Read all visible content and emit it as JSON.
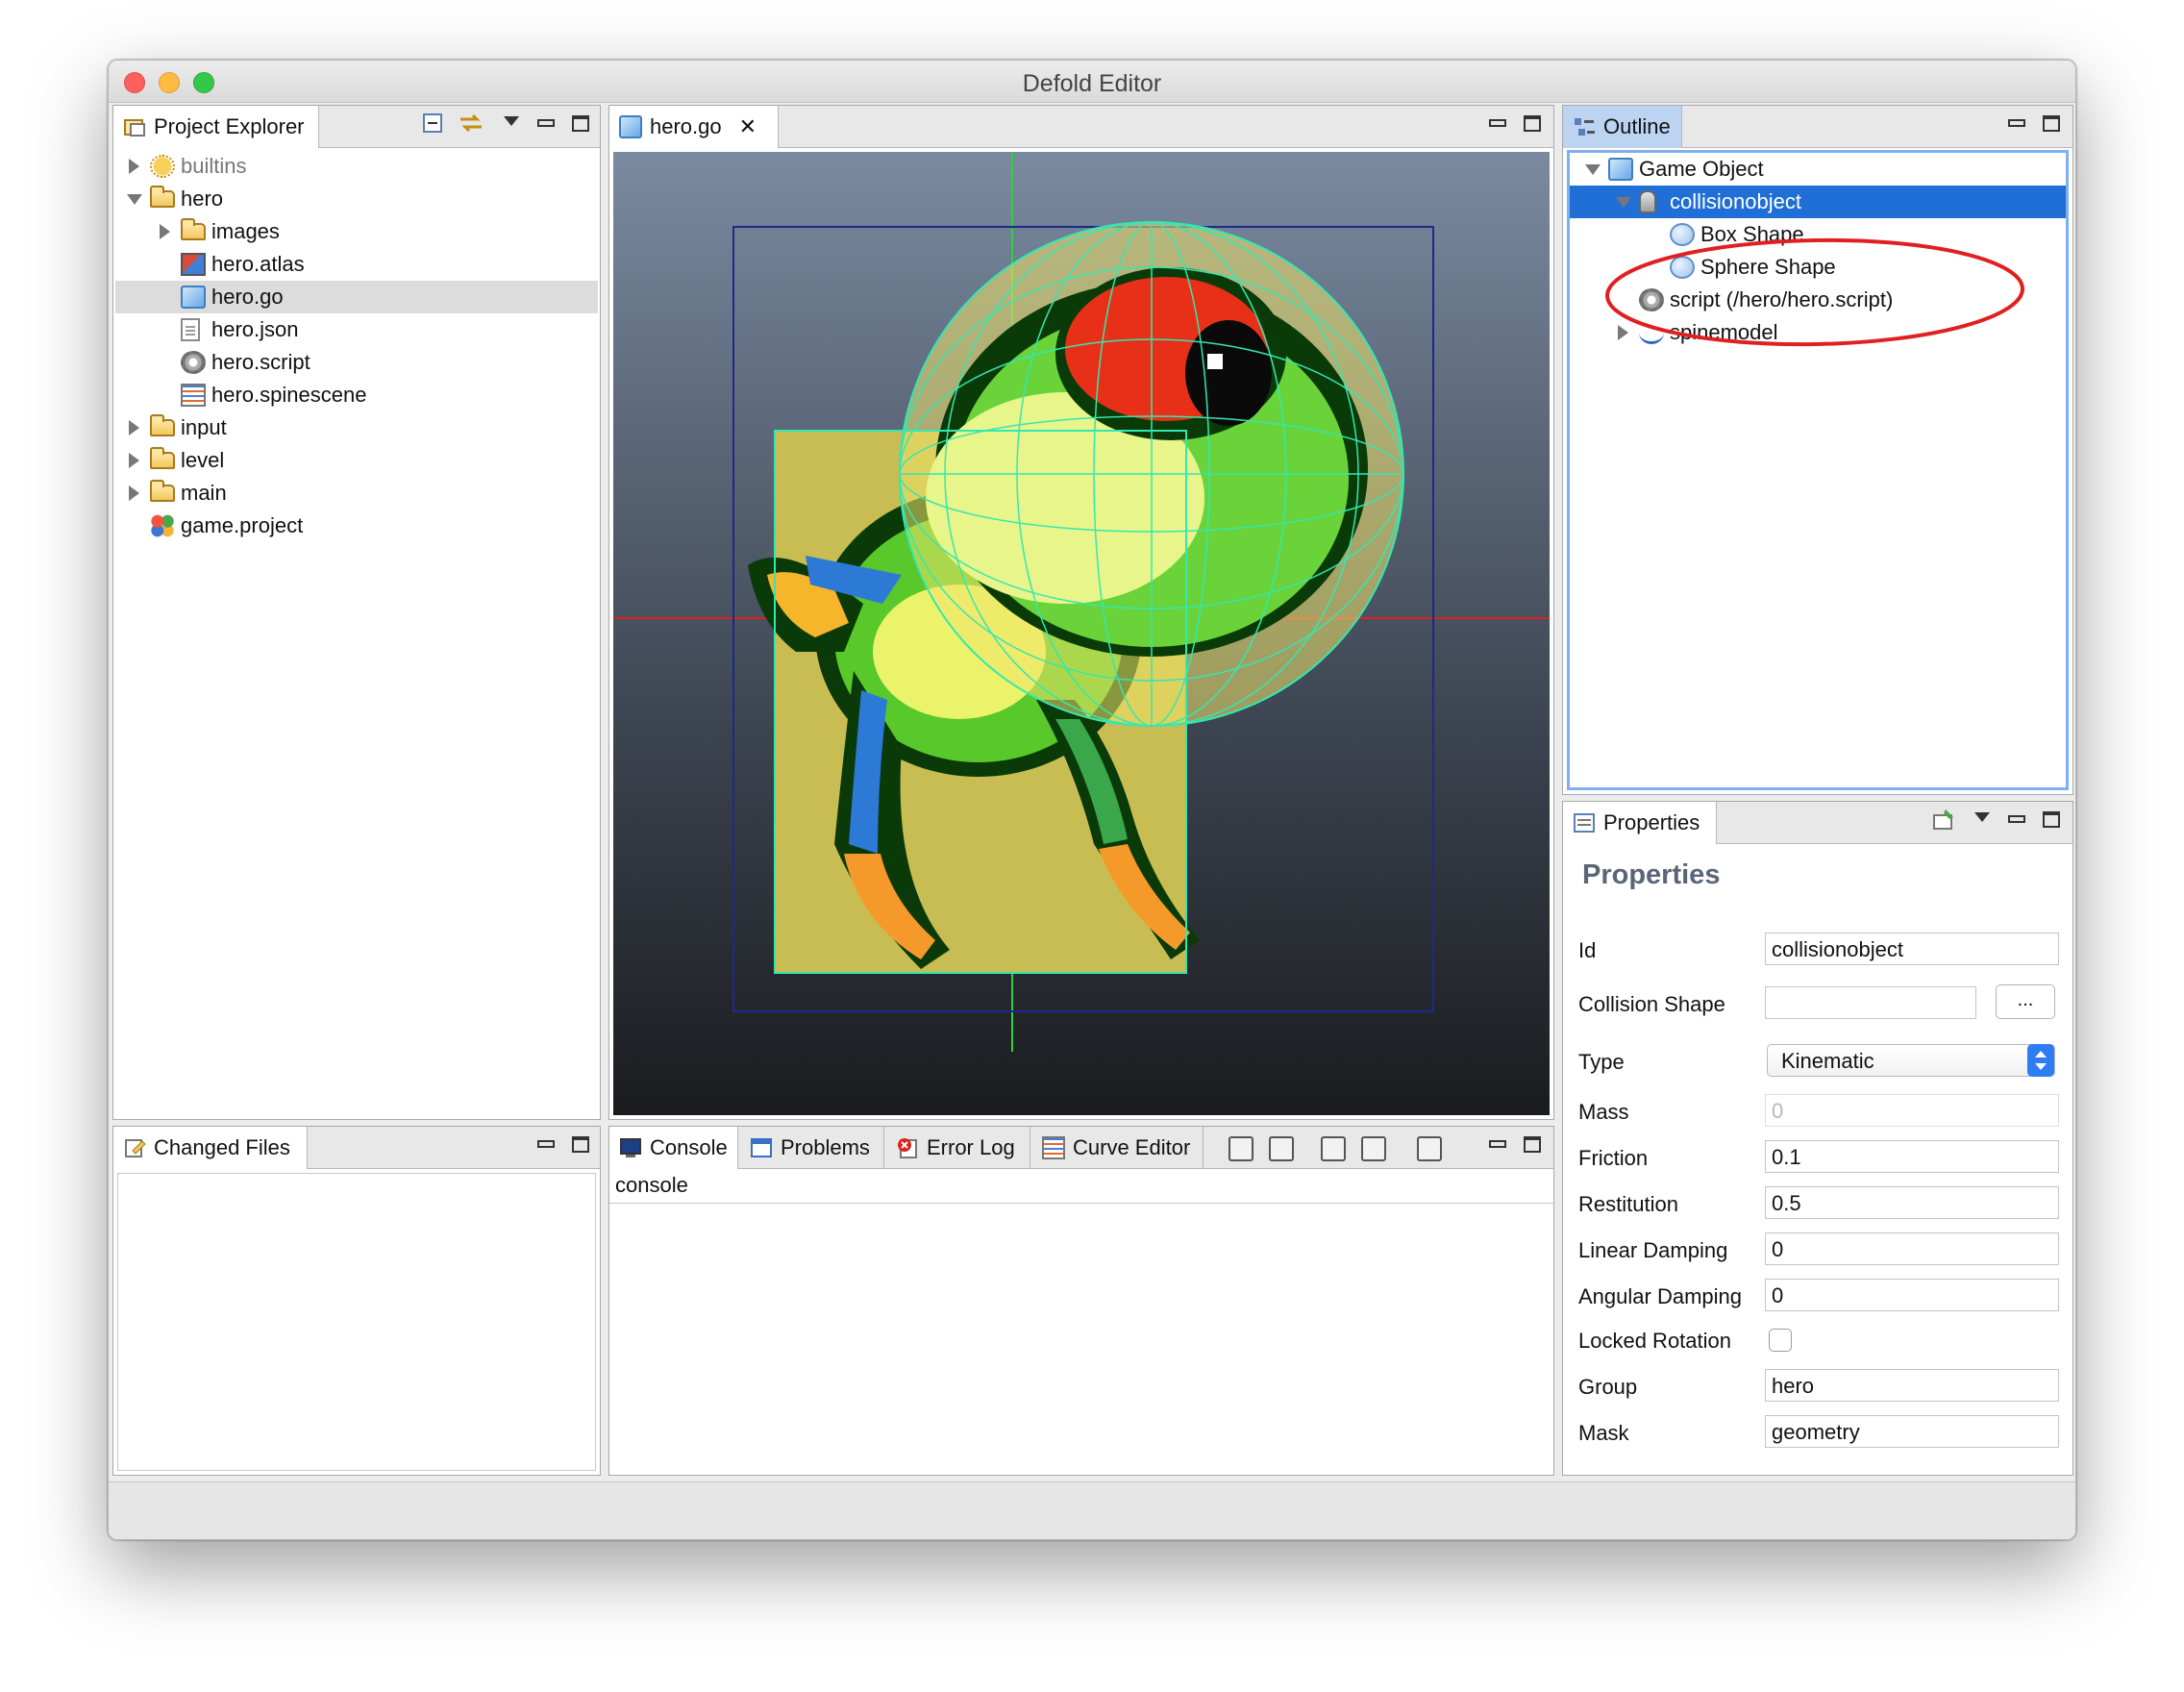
{
  "window": {
    "title": "Defold Editor"
  },
  "project_explorer": {
    "tab_label": "Project Explorer",
    "items": [
      {
        "label": "builtins",
        "icon": "builtins-icon",
        "depth": 0,
        "twisty": "closed",
        "muted": true
      },
      {
        "label": "hero",
        "icon": "folder-icon",
        "depth": 0,
        "twisty": "open"
      },
      {
        "label": "images",
        "icon": "folder-icon",
        "depth": 1,
        "twisty": "closed"
      },
      {
        "label": "hero.atlas",
        "icon": "atlas-icon",
        "depth": 1,
        "twisty": "none"
      },
      {
        "label": "hero.go",
        "icon": "game-object-icon",
        "depth": 1,
        "twisty": "none",
        "selected": true
      },
      {
        "label": "hero.json",
        "icon": "document-icon",
        "depth": 1,
        "twisty": "none"
      },
      {
        "label": "hero.script",
        "icon": "gear-icon",
        "depth": 1,
        "twisty": "none"
      },
      {
        "label": "hero.spinescene",
        "icon": "spinescene-icon",
        "depth": 1,
        "twisty": "none"
      },
      {
        "label": "input",
        "icon": "folder-icon",
        "depth": 0,
        "twisty": "closed"
      },
      {
        "label": "level",
        "icon": "folder-icon",
        "depth": 0,
        "twisty": "closed"
      },
      {
        "label": "main",
        "icon": "folder-icon",
        "depth": 0,
        "twisty": "closed"
      },
      {
        "label": "game.project",
        "icon": "project-icon",
        "depth": 0,
        "twisty": "none"
      }
    ]
  },
  "editor": {
    "tab_label": "hero.go"
  },
  "outline": {
    "tab_label": "Outline",
    "items": [
      {
        "label": "Game Object",
        "icon": "game-object-icon",
        "depth": 0,
        "twisty": "open"
      },
      {
        "label": "collisionobject",
        "icon": "collision-object-icon",
        "depth": 1,
        "twisty": "open",
        "highlighted": true
      },
      {
        "label": "Box Shape",
        "icon": "sphere-icon",
        "depth": 2,
        "twisty": "none"
      },
      {
        "label": "Sphere Shape",
        "icon": "sphere-icon",
        "depth": 2,
        "twisty": "none"
      },
      {
        "label": "script (/hero/hero.script)",
        "icon": "gear-icon",
        "depth": 1,
        "twisty": "none"
      },
      {
        "label": "spinemodel",
        "icon": "spinemodel-icon",
        "depth": 1,
        "twisty": "closed"
      }
    ]
  },
  "changed_files": {
    "tab_label": "Changed Files"
  },
  "bottom_tabs": {
    "console": "Console",
    "problems": "Problems",
    "error_log": "Error Log",
    "curve_editor": "Curve Editor",
    "console_header": "console"
  },
  "properties": {
    "tab_label": "Properties",
    "heading": "Properties",
    "id_label": "Id",
    "id_value": "collisionobject",
    "collision_shape_label": "Collision Shape",
    "collision_shape_value": "",
    "browse_label": "...",
    "type_label": "Type",
    "type_value": "Kinematic",
    "mass_label": "Mass",
    "mass_value": "0",
    "friction_label": "Friction",
    "friction_value": "0.1",
    "restitution_label": "Restitution",
    "restitution_value": "0.5",
    "linear_damping_label": "Linear Damping",
    "linear_damping_value": "0",
    "angular_damping_label": "Angular Damping",
    "angular_damping_value": "0",
    "locked_rotation_label": "Locked Rotation",
    "locked_rotation_checked": false,
    "group_label": "Group",
    "group_value": "hero",
    "mask_label": "Mask",
    "mask_value": "geometry"
  },
  "colors": {
    "selection": "#1f6fd6",
    "annotation": "#e02020",
    "collision_shape": "#33e8b0",
    "shape_fill": "#f0e36a"
  }
}
